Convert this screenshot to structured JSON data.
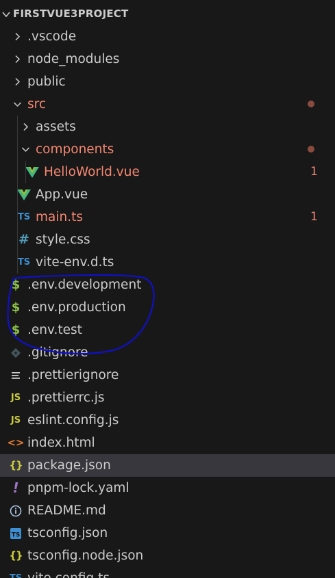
{
  "explorer": {
    "title": "FIRSTVUE3PROJECT",
    "items": [
      {
        "label": ".vscode",
        "kind": "folder",
        "expanded": false,
        "depth": 0
      },
      {
        "label": "node_modules",
        "kind": "folder",
        "expanded": false,
        "depth": 0
      },
      {
        "label": "public",
        "kind": "folder",
        "expanded": false,
        "depth": 0
      },
      {
        "label": "src",
        "kind": "folder",
        "expanded": true,
        "depth": 0,
        "error": true,
        "dot": true
      },
      {
        "label": "assets",
        "kind": "folder",
        "expanded": false,
        "depth": 1
      },
      {
        "label": "components",
        "kind": "folder",
        "expanded": true,
        "depth": 1,
        "error": true,
        "dot": true
      },
      {
        "label": "HelloWorld.vue",
        "kind": "file",
        "icon": "vue-icon",
        "depth": 2,
        "error": true,
        "badge": "1"
      },
      {
        "label": "App.vue",
        "kind": "file",
        "icon": "vue-icon",
        "depth": 1
      },
      {
        "label": "main.ts",
        "kind": "file",
        "icon": "ts-icon",
        "depth": 1,
        "error": true,
        "badge": "1"
      },
      {
        "label": "style.css",
        "kind": "file",
        "icon": "css-icon",
        "depth": 1
      },
      {
        "label": "vite-env.d.ts",
        "kind": "file",
        "icon": "ts-icon",
        "depth": 1
      },
      {
        "label": ".env.development",
        "kind": "file",
        "icon": "env-icon",
        "depth": 0
      },
      {
        "label": ".env.production",
        "kind": "file",
        "icon": "env-icon",
        "depth": 0
      },
      {
        "label": ".env.test",
        "kind": "file",
        "icon": "env-icon",
        "depth": 0
      },
      {
        "label": ".gitignore",
        "kind": "file",
        "icon": "git-icon",
        "depth": 0
      },
      {
        "label": ".prettierignore",
        "kind": "file",
        "icon": "lines-icon",
        "depth": 0
      },
      {
        "label": ".prettierrc.js",
        "kind": "file",
        "icon": "js-icon",
        "depth": 0
      },
      {
        "label": "eslint.config.js",
        "kind": "file",
        "icon": "js-icon",
        "depth": 0
      },
      {
        "label": "index.html",
        "kind": "file",
        "icon": "html-icon",
        "depth": 0
      },
      {
        "label": "package.json",
        "kind": "file",
        "icon": "json-icon",
        "depth": 0,
        "selected": true
      },
      {
        "label": "pnpm-lock.yaml",
        "kind": "file",
        "icon": "yaml-icon",
        "depth": 0
      },
      {
        "label": "README.md",
        "kind": "file",
        "icon": "info-icon",
        "depth": 0
      },
      {
        "label": "tsconfig.json",
        "kind": "file",
        "icon": "tsconfig-icon",
        "depth": 0
      },
      {
        "label": "tsconfig.node.json",
        "kind": "file",
        "icon": "json-icon",
        "depth": 0
      },
      {
        "label": "vite.config.ts",
        "kind": "file",
        "icon": "ts-icon",
        "depth": 0
      }
    ]
  },
  "colors": {
    "background": "#181818",
    "text": "#cccccc",
    "error_text": "#f48771",
    "selected_row": "#37373d",
    "annotation_stroke": "#1010c8"
  }
}
